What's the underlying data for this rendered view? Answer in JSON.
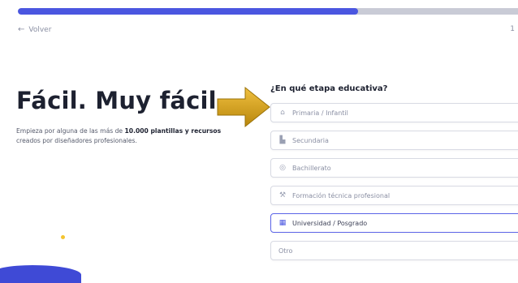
{
  "progress": {
    "fraction": 0.68,
    "track_color": "#c9cbd6",
    "fill_color": "#4a56e0"
  },
  "nav": {
    "back_icon": "arrow-left-icon",
    "back_label": "Volver",
    "step_label": "1"
  },
  "hero": {
    "title": "Fácil. Muy fácil",
    "desc_pre": "Empieza por alguna de las más de ",
    "desc_bold": "10.000 plantillas y recursos",
    "desc_post": " creados por diseñadores profesionales."
  },
  "form": {
    "question": "¿En qué etapa educativa?",
    "options": [
      {
        "label": "Primaria / Infantil",
        "icon": "school-icon",
        "glyph": "⌂",
        "selected": false
      },
      {
        "label": "Secundaria",
        "icon": "building-icon",
        "glyph": "▙",
        "selected": false
      },
      {
        "label": "Bachillerato",
        "icon": "graduation-icon",
        "glyph": "◎",
        "selected": false
      },
      {
        "label": "Formación técnica profesional",
        "icon": "tools-icon",
        "glyph": "⚒",
        "selected": false
      },
      {
        "label": "Universidad / Posgrado",
        "icon": "university-icon",
        "glyph": "▦",
        "selected": true
      },
      {
        "label": "Otro",
        "icon": "",
        "glyph": "",
        "selected": false
      }
    ]
  },
  "colors": {
    "accent": "#4a56e0",
    "pointer_arrow": "#d9a21c",
    "dot": "#f4c430"
  }
}
